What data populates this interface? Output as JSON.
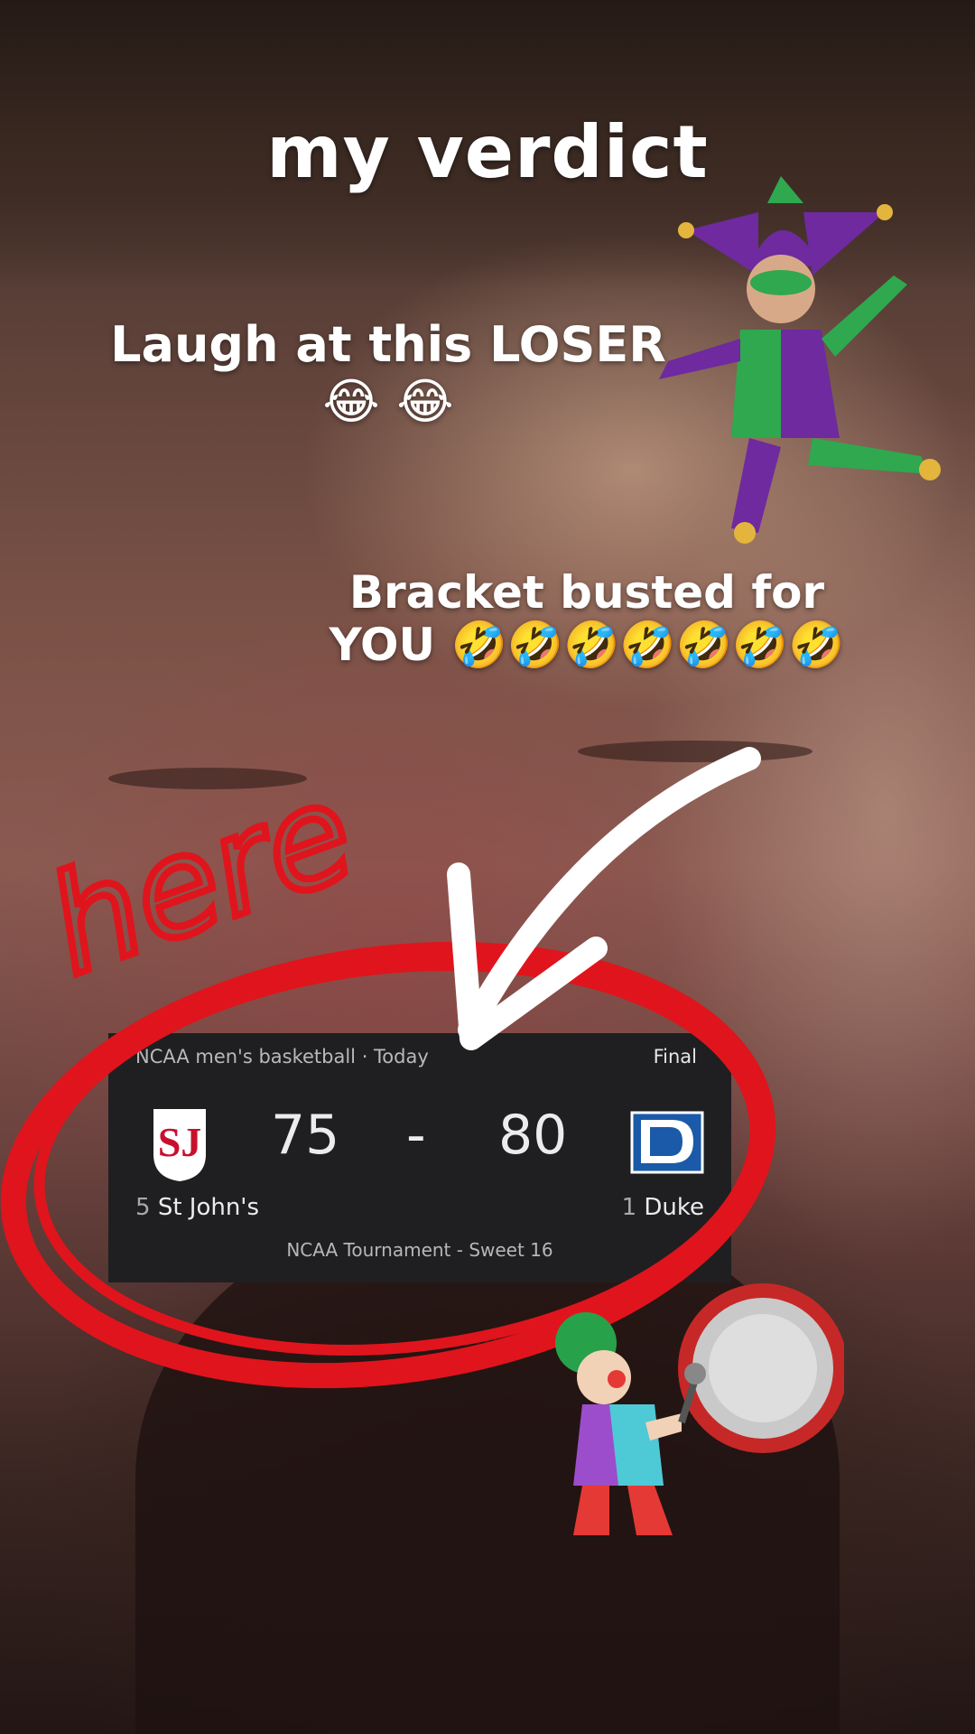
{
  "overlay_text": {
    "title": "my verdict",
    "caption1": "Laugh at this LOSER 😂 😂",
    "caption2": "Bracket busted for YOU 🤣🤣🤣🤣🤣🤣🤣",
    "handwritten": "here"
  },
  "scorecard": {
    "header_left": "NCAA men's basketball · Today",
    "header_right": "Final",
    "home_score": "75",
    "separator": "-",
    "away_score": "80",
    "home_team": "St John's",
    "home_seed": "5",
    "away_team": "Duke",
    "away_seed": "1",
    "round": "NCAA Tournament - Sweet 16"
  },
  "colors": {
    "circle_red": "#e0141c",
    "card_bg": "#1f1f21",
    "stjohns_red": "#c8102e",
    "duke_blue": "#1a5aa8"
  },
  "stickers": [
    "jester-sticker",
    "clown-drum-sticker",
    "white-arrow",
    "red-circle"
  ]
}
